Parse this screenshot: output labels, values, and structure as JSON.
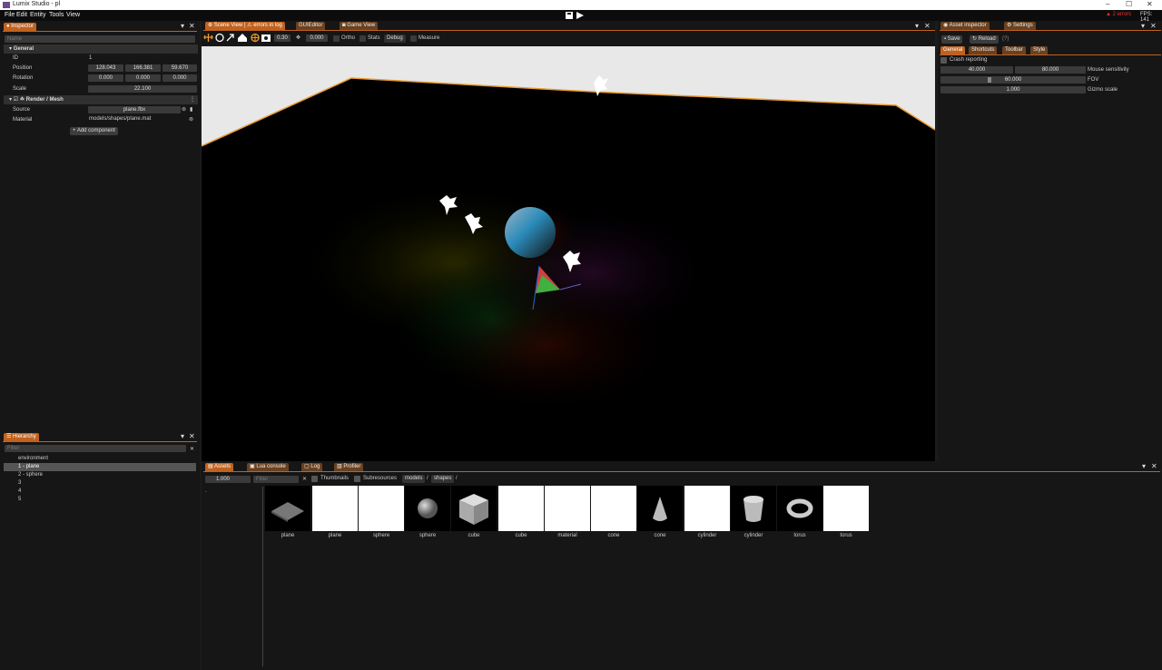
{
  "window": {
    "title": "Lumix Studio - pl",
    "minimize": "–",
    "maximize": "☐",
    "close": "✕"
  },
  "menu": [
    "File",
    "Edit",
    "Entity",
    "Tools",
    "View"
  ],
  "status": {
    "errors": "2 errors",
    "fps": "FPS: 141"
  },
  "inspector": {
    "tab": "Inspector",
    "name_placeholder": "Name",
    "general_header": "General",
    "id_label": "ID",
    "id_value": "1",
    "position_label": "Position",
    "position": [
      "128.043",
      "166.381",
      "59.670"
    ],
    "rotation_label": "Rotation",
    "rotation": [
      "0.000",
      "0.000",
      "0.000"
    ],
    "scale_label": "Scale",
    "scale": "22.100",
    "mesh_header": "Render / Mesh",
    "source_label": "Source",
    "source_value": "plane.fbx",
    "material_label": "Material",
    "material_value": "models/shapes/plane.mat",
    "add_component": "Add component"
  },
  "hierarchy": {
    "tab": "Hierarchy",
    "filter_placeholder": "Filter",
    "items": [
      "environment",
      "1 - plane",
      "2 - sphere",
      "3",
      "4",
      "5"
    ]
  },
  "scene": {
    "tabs": [
      "Scene View | ⚠ errors in log",
      "GUIEditor",
      "Game View"
    ],
    "camera_speed": "0.30",
    "snap": "0.000",
    "ortho": "Ortho",
    "stats": "Stats",
    "debug": "Debug",
    "measure": "Measure"
  },
  "asset_inspector": {
    "tabs": [
      "Asset inspector",
      "Settings"
    ],
    "save": "Save",
    "reload": "Reload",
    "help": "(?)",
    "subtabs": [
      "General",
      "Shortcuts",
      "Toolbar",
      "Style"
    ],
    "crash_reporting": "Crash reporting",
    "mouse_sens": [
      "40.000",
      "80.000"
    ],
    "mouse_sens_label": "Mouse sensitivity",
    "fov": "60.000",
    "fov_label": "FOV",
    "gizmo_scale": "1.000",
    "gizmo_label": "Gizmo scale"
  },
  "bottom": {
    "tabs": [
      "Assets",
      "Lua console",
      "Log",
      "Profiler"
    ],
    "thumb_size": "1.000",
    "filter_placeholder": "Filter",
    "thumbnails": "Thumbnails",
    "subresources": "Subresources",
    "breadcrumbs": [
      "models",
      "/",
      "shapes",
      "/"
    ],
    "tree_root": ".",
    "assets": [
      {
        "name": "plane",
        "preview": "plane-dark"
      },
      {
        "name": "plane",
        "preview": "blank"
      },
      {
        "name": "sphere",
        "preview": "blank"
      },
      {
        "name": "sphere",
        "preview": "sphere"
      },
      {
        "name": "cube",
        "preview": "cube"
      },
      {
        "name": "cube",
        "preview": "blank"
      },
      {
        "name": "material",
        "preview": "blank"
      },
      {
        "name": "cone",
        "preview": "blank"
      },
      {
        "name": "cone",
        "preview": "cone"
      },
      {
        "name": "cylinder",
        "preview": "blank"
      },
      {
        "name": "cylinder",
        "preview": "cylinder"
      },
      {
        "name": "torus",
        "preview": "torus"
      },
      {
        "name": "torus",
        "preview": "blank"
      }
    ]
  }
}
